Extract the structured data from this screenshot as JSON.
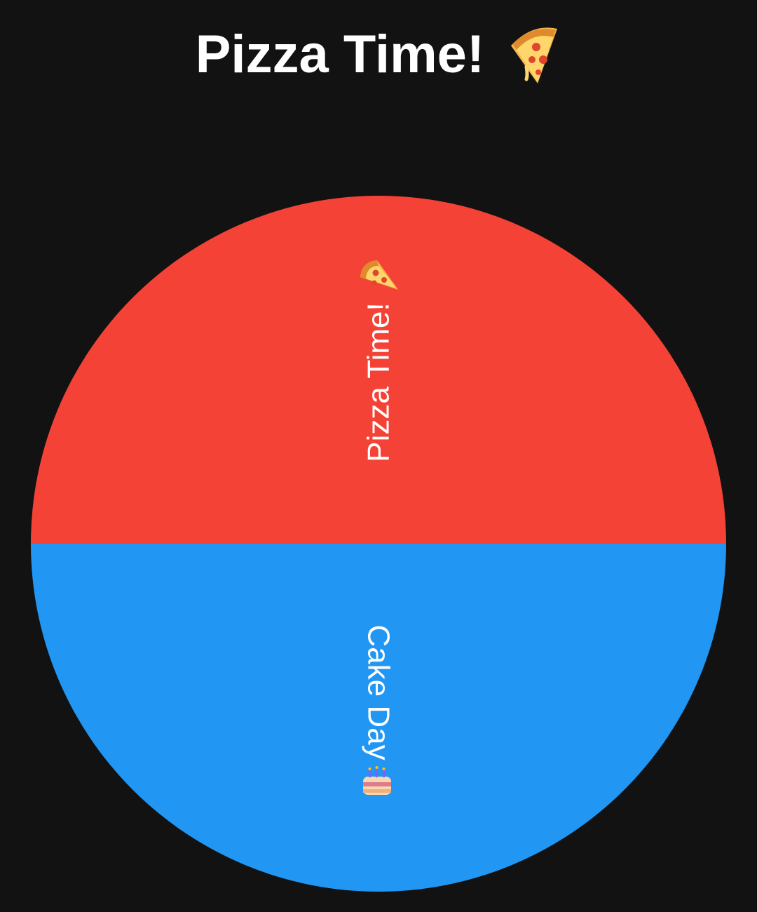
{
  "header": {
    "title": "Pizza Time!",
    "title_icon": "pizza-slice-icon"
  },
  "wheel": {
    "segments": [
      {
        "label": "Pizza Time!",
        "icon": "pizza-slice-icon",
        "color": "#F44336"
      },
      {
        "label": "Cake Day",
        "icon": "birthday-cake-icon",
        "color": "#2196F3"
      }
    ]
  },
  "colors": {
    "background": "#121212",
    "text": "#FFFFFF"
  }
}
